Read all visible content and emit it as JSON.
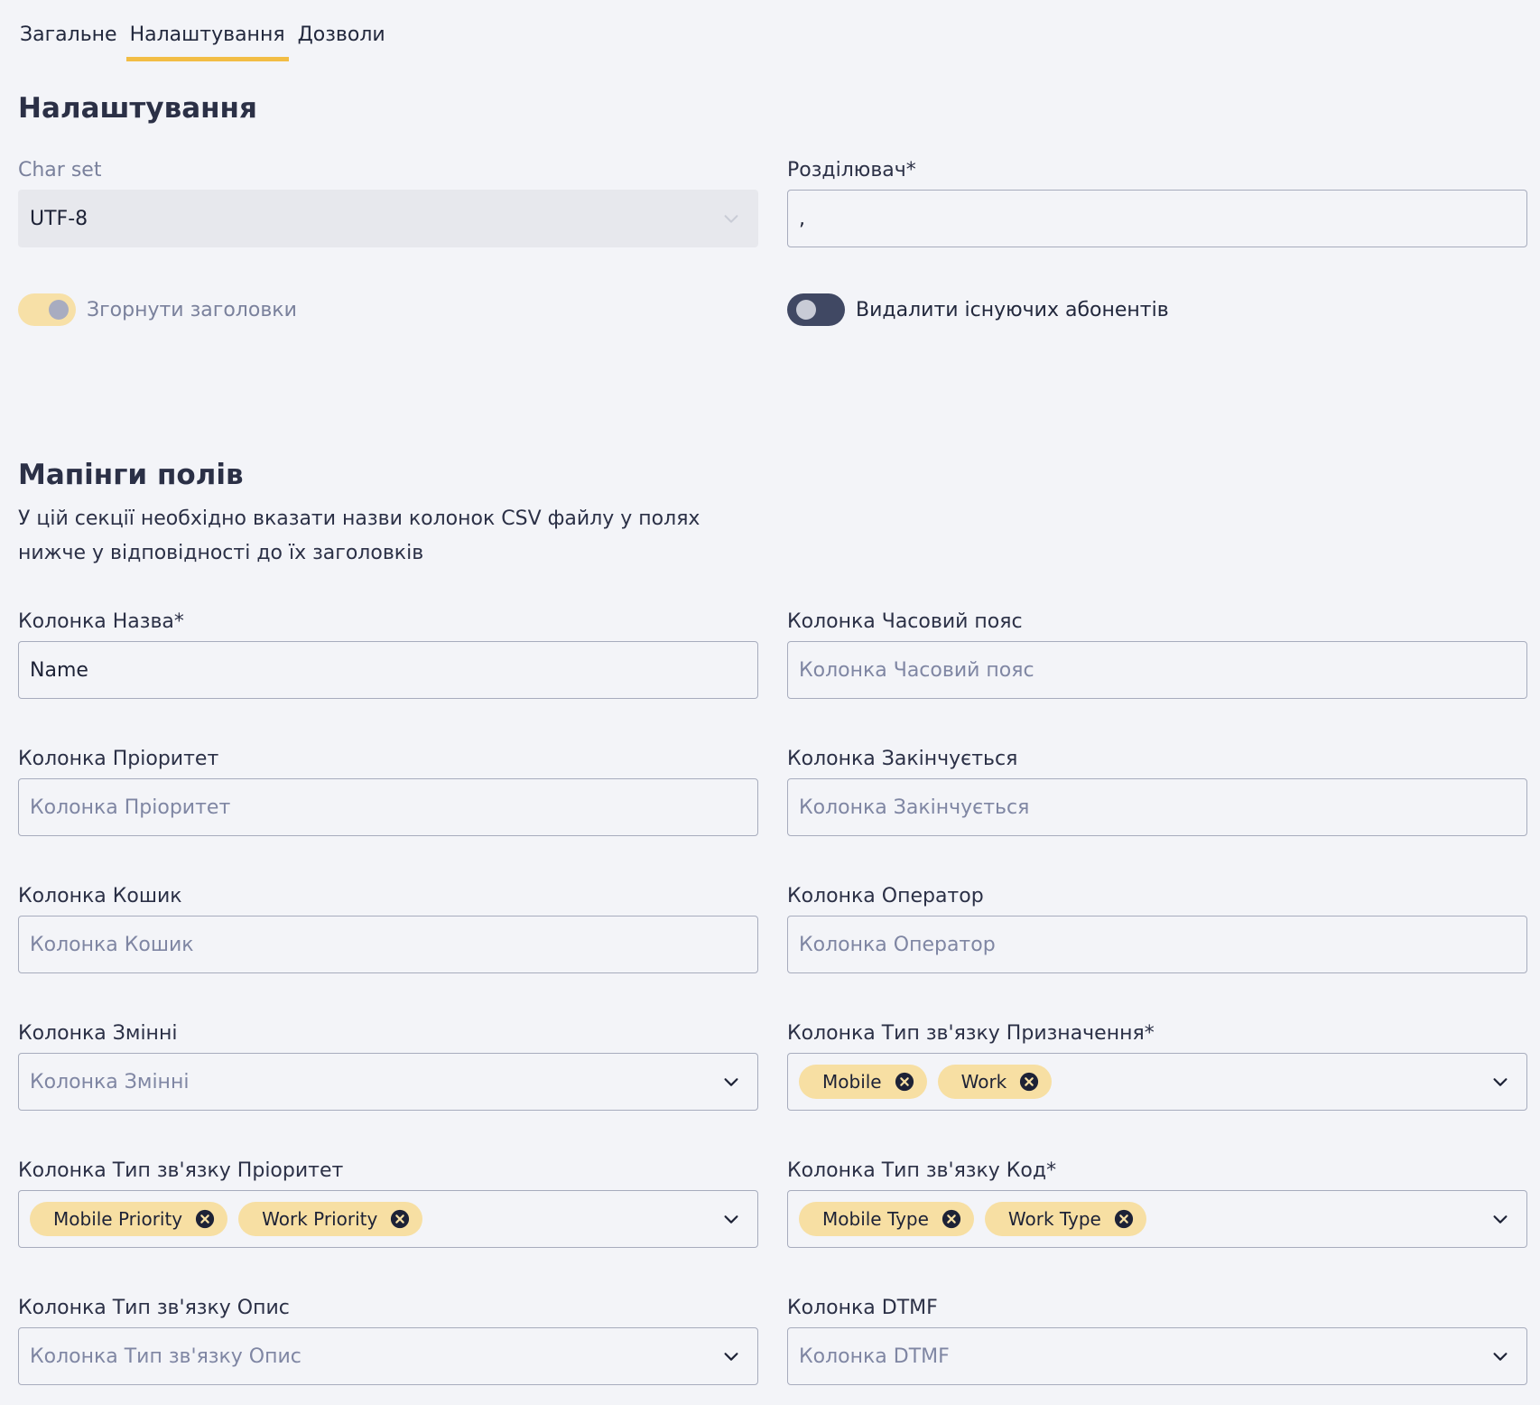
{
  "tabs": [
    {
      "label": "Загальне"
    },
    {
      "label": "Налаштування"
    },
    {
      "label": "Дозволи"
    }
  ],
  "settings": {
    "title": "Налаштування",
    "charset": {
      "label": "Char set",
      "value": "UTF-8"
    },
    "delimiter": {
      "label": "Розділювач*",
      "value": ","
    },
    "collapse_headers": {
      "label": "Згорнути заголовки",
      "enabled": true
    },
    "delete_existing": {
      "label": "Видалити існуючих абонентів",
      "enabled": false
    }
  },
  "mappings": {
    "title": "Мапінги полів",
    "description": "У цій секції необхідно вказати назви колонок CSV файлу у полях нижче у відповідності до їх заголовків",
    "name": {
      "label": "Колонка Назва*",
      "value": "Name"
    },
    "timezone": {
      "label": "Колонка Часовий пояс",
      "placeholder": "Колонка Часовий пояс"
    },
    "priority": {
      "label": "Колонка Пріоритет",
      "placeholder": "Колонка Пріоритет"
    },
    "expire": {
      "label": "Колонка Закінчується",
      "placeholder": "Колонка Закінчується"
    },
    "bucket": {
      "label": "Колонка Кошик",
      "placeholder": "Колонка Кошик"
    },
    "agent": {
      "label": "Колонка Оператор",
      "placeholder": "Колонка Оператор"
    },
    "variables": {
      "label": "Колонка Змінні",
      "placeholder": "Колонка Змінні"
    },
    "comm_destination": {
      "label": "Колонка Тип зв'язку Призначення*",
      "chips": [
        "Mobile",
        "Work"
      ]
    },
    "comm_priority": {
      "label": "Колонка Тип зв'язку Пріоритет",
      "chips": [
        "Mobile Priority",
        "Work Priority"
      ]
    },
    "comm_code": {
      "label": "Колонка Тип зв'язку Код*",
      "chips": [
        "Mobile Type",
        "Work Type"
      ]
    },
    "comm_description": {
      "label": "Колонка Тип зв'язку Опис",
      "placeholder": "Колонка Тип зв'язку Опис"
    },
    "dtmf": {
      "label": "Колонка DTMF",
      "placeholder": "Колонка DTMF"
    }
  },
  "icons": {
    "chevron": "chevron-down-icon",
    "chip_remove": "close-circle-icon"
  },
  "colors": {
    "accent": "#f2bd45",
    "chip_bg": "#f7dfa3",
    "toggle_off": "#404863",
    "background": "#f3f4f8"
  }
}
